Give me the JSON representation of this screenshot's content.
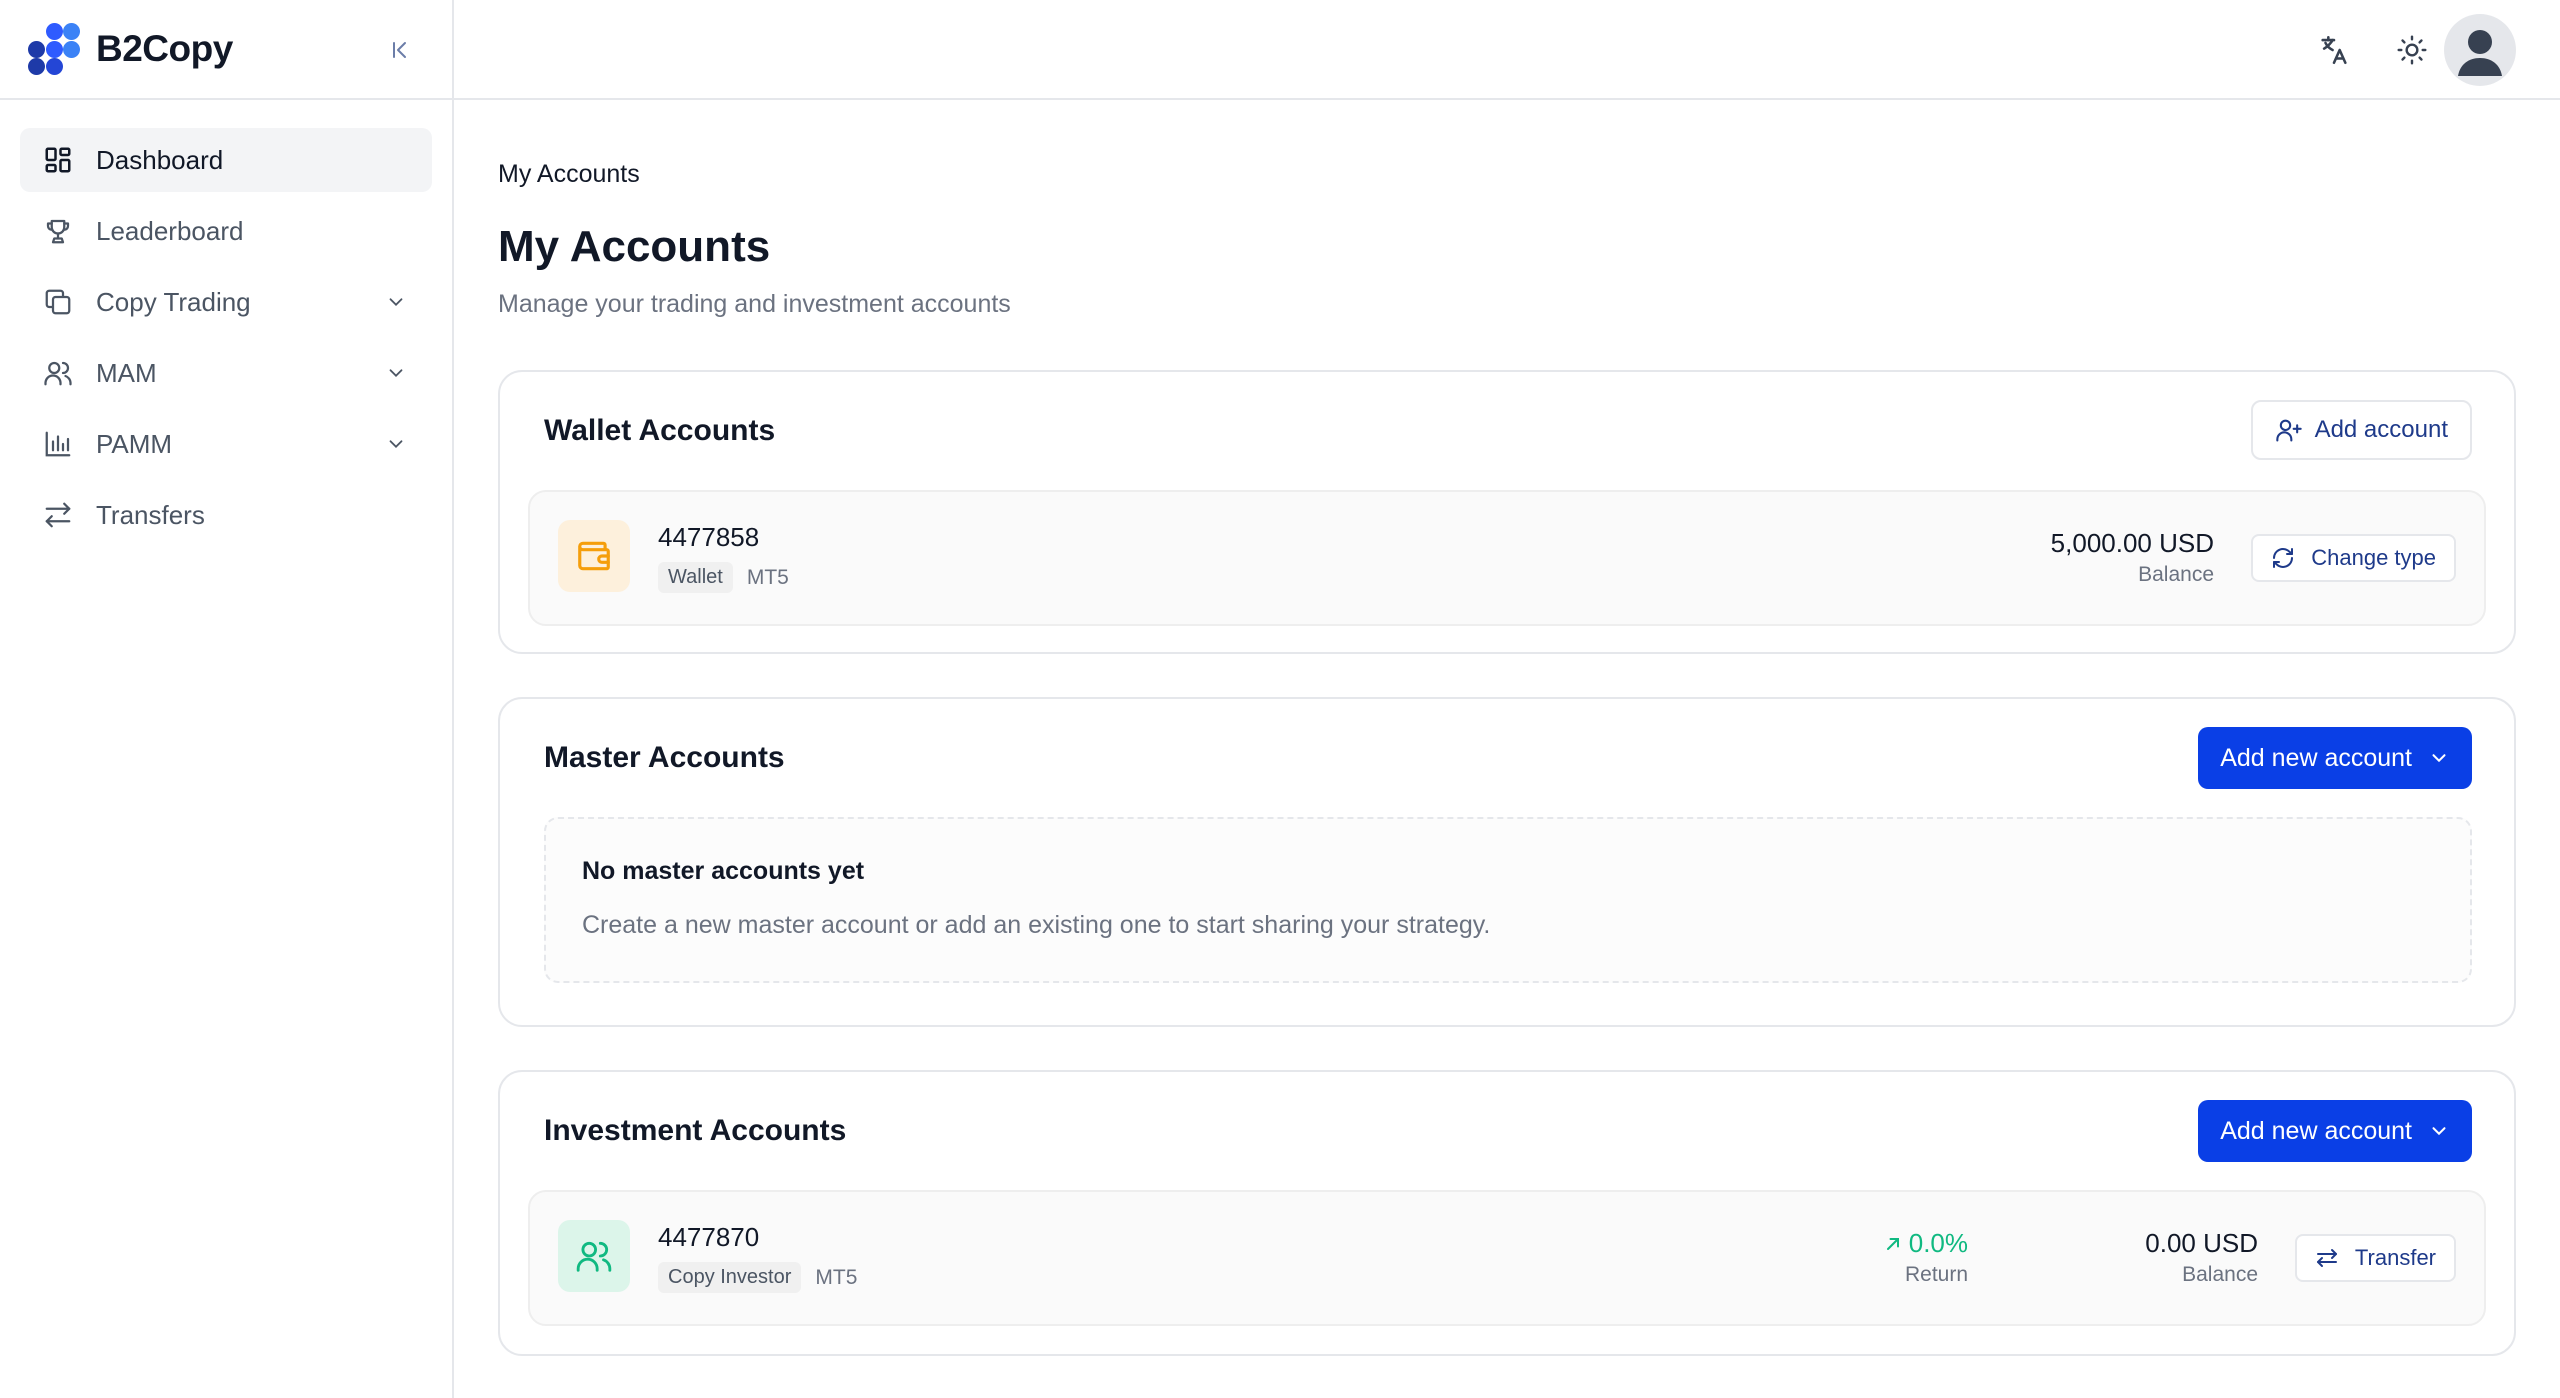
{
  "app": {
    "brand": "B2Copy"
  },
  "sidebar": {
    "items": [
      {
        "label": "Dashboard",
        "icon": "dashboard-icon",
        "active": true
      },
      {
        "label": "Leaderboard",
        "icon": "trophy-icon"
      },
      {
        "label": "Copy Trading",
        "icon": "copy-icon",
        "expandable": true
      },
      {
        "label": "MAM",
        "icon": "users-icon",
        "expandable": true
      },
      {
        "label": "PAMM",
        "icon": "bar-chart-icon",
        "expandable": true
      },
      {
        "label": "Transfers",
        "icon": "transfer-icon"
      }
    ]
  },
  "topbar": {
    "icons": [
      "translate-icon",
      "sun-icon"
    ],
    "avatar": "user-avatar"
  },
  "page": {
    "breadcrumb": "My Accounts",
    "title": "My Accounts",
    "subtitle": "Manage your trading and investment accounts"
  },
  "wallet": {
    "title": "Wallet Accounts",
    "add_label": "Add account",
    "account": {
      "number": "4477858",
      "type": "Wallet",
      "platform": "MT5",
      "balance": "5,000.00 USD",
      "balance_label": "Balance",
      "action_label": "Change type"
    }
  },
  "master": {
    "title": "Master Accounts",
    "add_label": "Add new account",
    "empty_title": "No master accounts yet",
    "empty_text": "Create a new master account or add an existing one to start sharing your strategy."
  },
  "investment": {
    "title": "Investment Accounts",
    "add_label": "Add new account",
    "account": {
      "number": "4477870",
      "type": "Copy Investor",
      "platform": "MT5",
      "return": "0.0%",
      "return_label": "Return",
      "balance": "0.00 USD",
      "balance_label": "Balance",
      "action_label": "Transfer"
    }
  },
  "colors": {
    "primary": "#0a3fe6",
    "wallet_icon_bg": "#fdf0dc",
    "wallet_icon": "#f59e0b",
    "investor_icon_bg": "#dcf5ea",
    "investor_icon": "#10b981",
    "positive": "#10b981"
  }
}
